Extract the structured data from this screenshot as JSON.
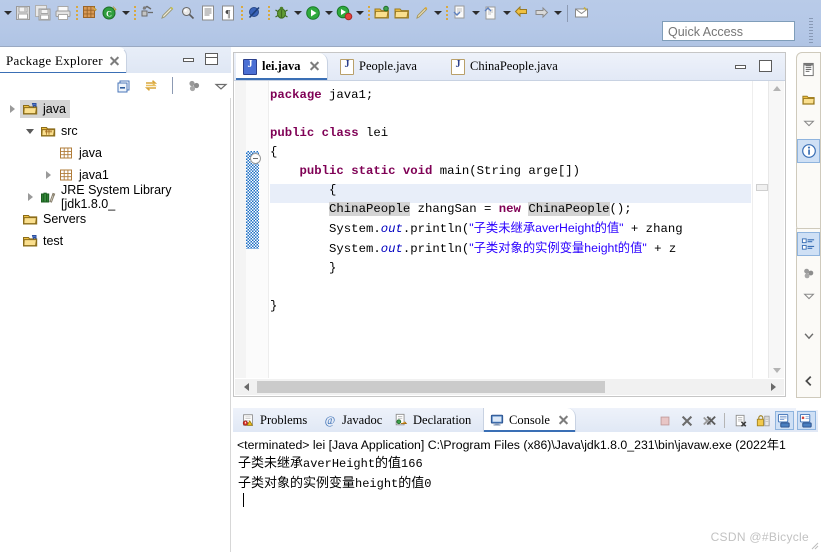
{
  "toolbar": {
    "icons": [
      {
        "name": "toolbar-dropdown-left",
        "glyph": "arrow"
      },
      {
        "name": "save-icon",
        "glyph": "save"
      },
      {
        "name": "save-all-icon",
        "glyph": "save-all"
      },
      {
        "name": "print-icon",
        "glyph": "print"
      },
      {
        "name": "separator",
        "glyph": "sep"
      },
      {
        "name": "new-java-package-icon",
        "glyph": "package"
      },
      {
        "name": "new-java-class-icon",
        "glyph": "class"
      },
      {
        "name": "dropdown-icon",
        "glyph": "arrow"
      },
      {
        "name": "separator",
        "glyph": "sep"
      },
      {
        "name": "refactor-icon",
        "glyph": "refactor"
      },
      {
        "name": "quick-fix-icon",
        "glyph": "pen"
      },
      {
        "name": "search-icon",
        "glyph": "search"
      },
      {
        "name": "open-type-icon",
        "glyph": "doc"
      },
      {
        "name": "paragraph-icon",
        "glyph": "pilcrow"
      },
      {
        "name": "separator",
        "glyph": "sep"
      },
      {
        "name": "skip-breakpoints-icon",
        "glyph": "nobreak"
      },
      {
        "name": "separator",
        "glyph": "sep"
      },
      {
        "name": "debug-icon",
        "glyph": "bug"
      },
      {
        "name": "debug-dropdown-icon",
        "glyph": "arrow"
      },
      {
        "name": "run-icon",
        "glyph": "run"
      },
      {
        "name": "run-dropdown-icon",
        "glyph": "arrow"
      },
      {
        "name": "run-external-icon",
        "glyph": "run2"
      },
      {
        "name": "external-dropdown-icon",
        "glyph": "arrow"
      },
      {
        "name": "separator",
        "glyph": "sep"
      },
      {
        "name": "open-folder-icon",
        "glyph": "folder-green"
      },
      {
        "name": "open-resource-icon",
        "glyph": "folder"
      },
      {
        "name": "edit-icon",
        "glyph": "brush"
      },
      {
        "name": "edit-dropdown-icon",
        "glyph": "arrow"
      },
      {
        "name": "separator",
        "glyph": "sep"
      },
      {
        "name": "next-annotation-icon",
        "glyph": "next-ann"
      },
      {
        "name": "next-annotation-dropdown-icon",
        "glyph": "arrow"
      },
      {
        "name": "previous-annotation-icon",
        "glyph": "prev-ann"
      },
      {
        "name": "previous-annotation-dropdown-icon",
        "glyph": "arrow"
      },
      {
        "name": "back-icon",
        "glyph": "back"
      },
      {
        "name": "forward-icon",
        "glyph": "fwd"
      },
      {
        "name": "forward-dropdown-icon",
        "glyph": "arrow"
      },
      {
        "name": "vseparator",
        "glyph": "vsep"
      },
      {
        "name": "last-edit-location-icon",
        "glyph": "lastedit"
      }
    ],
    "quick_access_placeholder": "Quick Access"
  },
  "package_explorer": {
    "title": "Package Explorer",
    "tools": [
      {
        "name": "collapse-all-icon",
        "label": "Collapse All"
      },
      {
        "name": "link-with-editor-icon",
        "label": "Link with Editor"
      },
      {
        "name": "view-menu-icon",
        "label": "View Menu"
      },
      {
        "name": "view-menu-chevron-icon",
        "label": "Menu"
      }
    ],
    "tree": [
      {
        "label": "java",
        "icon": "java-project-icon",
        "indent": 0,
        "twisty": "right",
        "selected": true
      },
      {
        "label": "src",
        "icon": "source-folder-icon",
        "indent": 1,
        "twisty": "down",
        "selected": false
      },
      {
        "label": "java",
        "icon": "package-icon",
        "indent": 2,
        "twisty": "none",
        "selected": false
      },
      {
        "label": "java1",
        "icon": "package-icon",
        "indent": 2,
        "twisty": "right",
        "selected": false
      },
      {
        "label": "JRE System Library [jdk1.8.0_",
        "icon": "jre-library-icon",
        "indent": 1,
        "twisty": "right",
        "selected": false
      },
      {
        "label": "Servers",
        "icon": "folder-icon",
        "indent": 0,
        "twisty": "none",
        "selected": false
      },
      {
        "label": "test",
        "icon": "java-project-icon",
        "indent": 0,
        "twisty": "none",
        "selected": false
      }
    ]
  },
  "editor": {
    "tabs": [
      {
        "label": "lei.java",
        "active": true,
        "closable": true
      },
      {
        "label": "People.java",
        "active": false,
        "closable": false
      },
      {
        "label": "ChinaPeople.java",
        "active": false,
        "closable": false
      }
    ],
    "window_buttons": [
      {
        "name": "editor-minimize-button"
      },
      {
        "name": "editor-maximize-button"
      }
    ],
    "code": {
      "line1_kw": "package",
      "line1_rest": " java1;",
      "line3_kw1": "public",
      "line3_kw2": "class",
      "line3_rest": " lei",
      "line4": "{",
      "line5_indent": "    ",
      "line5_kw1": "public",
      "line5_kw2": "static",
      "line5_kw3": "void",
      "line5_rest": " main(String arge[])",
      "line6": "        {",
      "line7_type": "ChinaPeople",
      "line7_mid": " zhangSan = ",
      "line7_kw": "new",
      "line7_type2": "ChinaPeople",
      "line7_end": "();",
      "line8_pre": "System.",
      "line8_fld": "out",
      "line8_mid": ".println(",
      "line8_str": "\"子类未继承averHeight的值\"",
      "line8_end": " + zhang",
      "line9_pre": "System.",
      "line9_fld": "out",
      "line9_mid": ".println(",
      "line9_str": "\"子类对象的实例变量height的值\"",
      "line9_end": " + z",
      "line10": "        }",
      "line12": "}"
    }
  },
  "console": {
    "tabs": [
      {
        "label": "Problems",
        "icon": "problems-icon",
        "active": false
      },
      {
        "label": "Javadoc",
        "icon": "javadoc-icon",
        "active": false
      },
      {
        "label": "Declaration",
        "icon": "declaration-icon",
        "active": false
      },
      {
        "label": "Console",
        "icon": "console-icon",
        "active": true,
        "closable": true
      }
    ],
    "tools": [
      {
        "name": "terminate-button",
        "pressed": false
      },
      {
        "name": "remove-launch-button",
        "pressed": false
      },
      {
        "name": "remove-all-terminated-button",
        "pressed": false
      },
      {
        "name": "clear-console-button",
        "pressed": false
      },
      {
        "name": "scroll-lock-button",
        "pressed": false
      },
      {
        "name": "pin-console-button",
        "pressed": true
      },
      {
        "name": "display-selected-console-button",
        "pressed": true
      }
    ],
    "terminated_line": "<terminated> lei [Java Application] C:\\Program Files (x86)\\Java\\jdk1.8.0_231\\bin\\javaw.exe (2022年1",
    "output_lines": [
      {
        "text": "子类未继承",
        "mono": "averHeight",
        "text2": "的值",
        "mono2": "166"
      },
      {
        "text": "子类对象的实例变量",
        "mono": "height",
        "text2": "的值",
        "mono2": "0"
      }
    ]
  },
  "right_stacks": {
    "top": [
      {
        "name": "outline-view-icon",
        "selected": false
      },
      {
        "name": "task-list-icon",
        "selected": false
      },
      {
        "name": "restore-chevron-icon",
        "selected": false
      },
      {
        "name": "information-view-icon",
        "selected": true
      }
    ],
    "bottom": [
      {
        "name": "outline-tree-icon",
        "selected": true
      },
      {
        "name": "view-menu-icon",
        "selected": false
      },
      {
        "name": "menu-chevron-icon",
        "selected": false
      },
      {
        "name": "scroll-down-chevron-icon",
        "selected": false
      },
      {
        "name": "restore-left-chevron-icon",
        "selected": false
      }
    ]
  },
  "watermark": "CSDN @#Bicycle"
}
